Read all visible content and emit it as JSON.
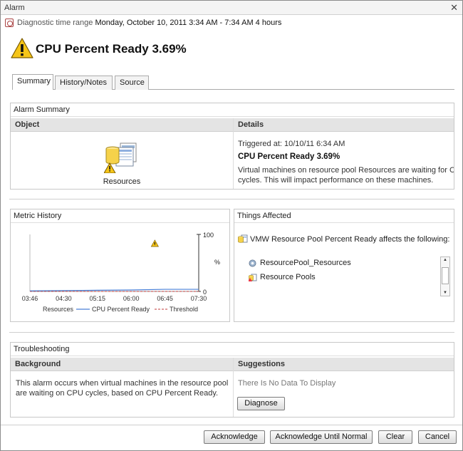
{
  "window": {
    "title": "Alarm",
    "close_glyph": "✕"
  },
  "time_range": {
    "label": "Diagnostic time range",
    "value": "Monday, October 10, 2011  3:34 AM - 7:34 AM  4 hours"
  },
  "alarm": {
    "title": "CPU Percent Ready 3.69%"
  },
  "tabs": [
    {
      "label": "Summary",
      "active": true
    },
    {
      "label": "History/Notes",
      "active": false
    },
    {
      "label": "Source",
      "active": false
    }
  ],
  "alarm_summary": {
    "title": "Alarm Summary",
    "object_header": "Object",
    "details_header": "Details",
    "object_label": "Resources",
    "triggered": "Triggered at: 10/10/11 6:34 AM",
    "details_title": "CPU Percent Ready 3.69%",
    "details_line1": "Virtual machines on resource pool Resources are waiting for CPU",
    "details_line2": "cycles. This will impact performance on these machines."
  },
  "metric_history": {
    "title": "Metric History",
    "legend_resources": "Resources",
    "legend_cpu": "CPU Percent Ready",
    "legend_threshold": "Threshold",
    "cpu_color": "#4a7fd6",
    "threshold_color": "#c23b3b",
    "chart_data": {
      "type": "line",
      "x": [
        "03:46",
        "04:30",
        "05:15",
        "06:00",
        "06:45",
        "07:30"
      ],
      "ylim": [
        0,
        100
      ],
      "ylabel": "%",
      "yticks": [
        "100",
        "0"
      ],
      "series": [
        {
          "name": "CPU Percent Ready",
          "values": [
            1,
            1.5,
            2,
            2.5,
            3.69,
            3.69
          ]
        },
        {
          "name": "Threshold",
          "values": [
            0,
            0,
            0,
            0,
            0,
            0
          ]
        }
      ]
    }
  },
  "things_affected": {
    "title": "Things Affected",
    "heading": "VMW Resource Pool Percent Ready affects the following:",
    "items": [
      "ResourcePool_Resources",
      "Resource Pools"
    ]
  },
  "troubleshooting": {
    "title": "Troubleshooting",
    "background_header": "Background",
    "suggestions_header": "Suggestions",
    "background_line1": "This alarm occurs when virtual machines in the resource pool",
    "background_line2": "are waiting on CPU cycles, based on CPU Percent Ready.",
    "no_data": "There Is No Data To Display",
    "diagnose_label": "Diagnose"
  },
  "buttons": {
    "acknowledge": "Acknowledge",
    "acknowledge_until_normal": "Acknowledge Until Normal",
    "clear": "Clear",
    "cancel": "Cancel"
  }
}
